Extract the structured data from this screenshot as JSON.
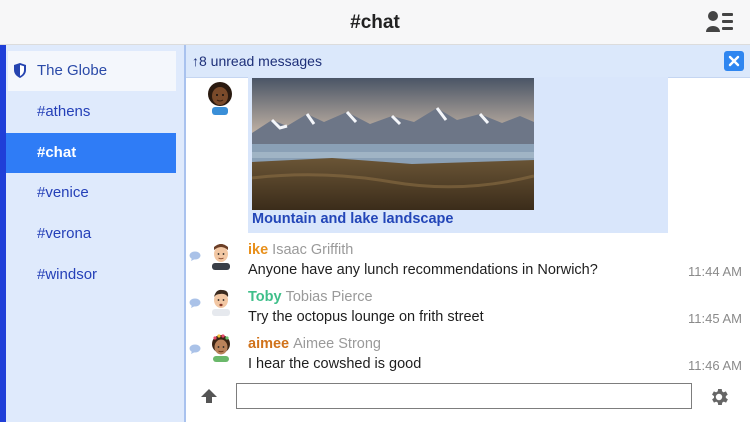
{
  "header": {
    "title": "#chat",
    "users_icon": "user-list-icon"
  },
  "sidebar": {
    "server": {
      "label": "The Globe",
      "icon": "shield-icon"
    },
    "channels": [
      {
        "label": "#athens",
        "active": false
      },
      {
        "label": "#chat",
        "active": true
      },
      {
        "label": "#venice",
        "active": false
      },
      {
        "label": "#verona",
        "active": false
      },
      {
        "label": "#windsor",
        "active": false
      }
    ]
  },
  "unread_banner": {
    "text": "↑8 unread messages",
    "close_icon": "close-icon"
  },
  "image_message": {
    "caption": "Mountain and lake landscape"
  },
  "messages": [
    {
      "nick": "ike",
      "realname": "Isaac Griffith",
      "text": "Anyone have any lunch recommendations in Norwich?",
      "time": "11:44 AM",
      "nick_color": "#e8901c"
    },
    {
      "nick": "Toby",
      "realname": "Tobias Pierce",
      "text": "Try the octopus lounge on frith street",
      "time": "11:45 AM",
      "nick_color": "#3fbf8a"
    },
    {
      "nick": "aimee",
      "realname": "Aimee Strong",
      "text": "I hear the cowshed is good",
      "time": "11:46 AM",
      "nick_color": "#d0721a"
    }
  ],
  "composer": {
    "placeholder": "",
    "upload_icon": "upload-icon",
    "settings_icon": "gear-icon"
  },
  "colors": {
    "accent": "#2f7cf6",
    "sidebar_bg": "#dfeafc",
    "link": "#2346b8"
  }
}
